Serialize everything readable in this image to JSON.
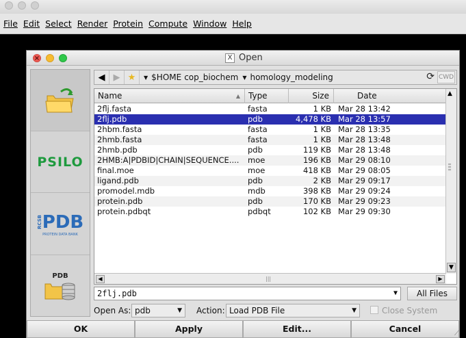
{
  "menu": [
    "File",
    "Edit",
    "Select",
    "Render",
    "Protein",
    "Compute",
    "Window",
    "Help"
  ],
  "dialog": {
    "title": "Open",
    "close_glyph": "×"
  },
  "sidebar": {
    "items": [
      {
        "name": "local-files",
        "label": ""
      },
      {
        "name": "psilo",
        "label": "PSILO"
      },
      {
        "name": "rcsb-pdb",
        "label": "PDB",
        "sub": "PROTEIN DATA BANK",
        "side": "RCSB"
      },
      {
        "name": "pdb-db",
        "label": "PDB"
      }
    ]
  },
  "path": {
    "crumbs": [
      "$HOME",
      "cop_biochem",
      "homology_modeling"
    ],
    "cwd_label": "CWD"
  },
  "table": {
    "headers": {
      "name": "Name",
      "type": "Type",
      "size": "Size",
      "date": "Date"
    },
    "rows": [
      {
        "name": "2flj.fasta",
        "type": "fasta",
        "size": "1 KB",
        "date": "Mar 28 13:42"
      },
      {
        "name": "2flj.pdb",
        "type": "pdb",
        "size": "4,478 KB",
        "date": "Mar 28 13:57",
        "selected": true
      },
      {
        "name": "2hbm.fasta",
        "type": "fasta",
        "size": "1 KB",
        "date": "Mar 28 13:35"
      },
      {
        "name": "2hmb.fasta",
        "type": "fasta",
        "size": "1 KB",
        "date": "Mar 28 13:48"
      },
      {
        "name": "2hmb.pdb",
        "type": "pdb",
        "size": "119 KB",
        "date": "Mar 28 13:48"
      },
      {
        "name": "2HMB:A|PDBID|CHAIN|SEQUENCE....",
        "type": "moe",
        "size": "196 KB",
        "date": "Mar 29 08:10"
      },
      {
        "name": "final.moe",
        "type": "moe",
        "size": "418 KB",
        "date": "Mar 29 08:05"
      },
      {
        "name": "ligand.pdb",
        "type": "pdb",
        "size": "2 KB",
        "date": "Mar 29 09:17"
      },
      {
        "name": "promodel.mdb",
        "type": "mdb",
        "size": "398 KB",
        "date": "Mar 29 09:24"
      },
      {
        "name": "protein.pdb",
        "type": "pdb",
        "size": "170 KB",
        "date": "Mar 29 09:23"
      },
      {
        "name": "protein.pdbqt",
        "type": "pdbqt",
        "size": "102 KB",
        "date": "Mar 29 09:30"
      }
    ]
  },
  "filename": {
    "value": "2flj.pdb",
    "filter_label": "All Files"
  },
  "options": {
    "open_as_label": "Open As:",
    "open_as_value": "pdb",
    "action_label": "Action:",
    "action_value": "Load PDB File",
    "close_system_label": "Close System"
  },
  "buttons": {
    "ok": "OK",
    "apply": "Apply",
    "edit": "Edit...",
    "cancel": "Cancel"
  },
  "colors": {
    "selection": "#2a2fb0",
    "psilo_green": "#1e9a3e",
    "pdb_blue": "#2b6bb8"
  }
}
